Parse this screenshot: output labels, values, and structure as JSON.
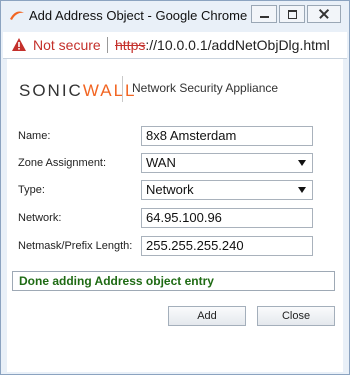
{
  "window": {
    "title": "Add Address Object - Google Chrome",
    "controls": {
      "minimize": "minimize",
      "maximize": "maximize",
      "close": "close"
    }
  },
  "address_bar": {
    "security_label": "Not secure",
    "url_protocol": "https",
    "url_rest": "://10.0.0.1/addNetObjDlg.html"
  },
  "brand": {
    "logo_left": "SONIC",
    "logo_right": "WALL",
    "subtitle": "Network Security Appliance"
  },
  "form": {
    "name_label": "Name:",
    "name_value": "8x8 Amsterdam",
    "zone_label": "Zone Assignment:",
    "zone_value": "WAN",
    "type_label": "Type:",
    "type_value": "Network",
    "network_label": "Network:",
    "network_value": "64.95.100.96",
    "netmask_label": "Netmask/Prefix Length:",
    "netmask_value": "255.255.255.240"
  },
  "status": {
    "message": "Done adding Address object entry"
  },
  "buttons": {
    "add_label": "Add",
    "close_label": "Close"
  },
  "colors": {
    "accent": "#f26522",
    "warning": "#c4302b",
    "success": "#1f6b14"
  }
}
